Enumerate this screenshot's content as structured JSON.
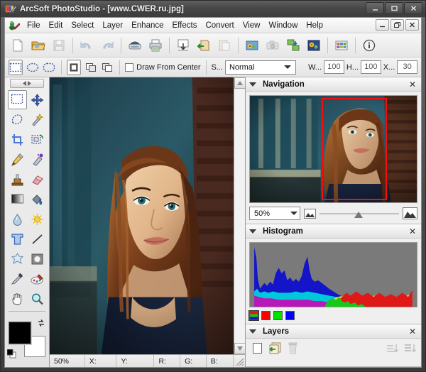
{
  "window": {
    "title": "ArcSoft PhotoStudio - [www.CWER.ru.jpg]",
    "app_icon": "photostudio-icon",
    "controls": {
      "minimize": "_",
      "maximize": "☐",
      "close": "✕"
    }
  },
  "mdi": {
    "icon": "document-icon",
    "controls": {
      "minimize": "_",
      "restore": "❐",
      "close": "✕"
    }
  },
  "menu": {
    "items": [
      {
        "label": "File",
        "name": "menu-file"
      },
      {
        "label": "Edit",
        "name": "menu-edit"
      },
      {
        "label": "Select",
        "name": "menu-select"
      },
      {
        "label": "Layer",
        "name": "menu-layer"
      },
      {
        "label": "Enhance",
        "name": "menu-enhance"
      },
      {
        "label": "Effects",
        "name": "menu-effects"
      },
      {
        "label": "Convert",
        "name": "menu-convert"
      },
      {
        "label": "View",
        "name": "menu-view"
      },
      {
        "label": "Window",
        "name": "menu-window"
      },
      {
        "label": "Help",
        "name": "menu-help"
      }
    ]
  },
  "toolbar": {
    "buttons": [
      {
        "icon": "new-file-icon",
        "name": "new-button"
      },
      {
        "icon": "open-folder-icon",
        "name": "open-button"
      },
      {
        "icon": "save-disk-icon",
        "name": "save-button"
      },
      {
        "icon": "undo-arrow-icon",
        "name": "undo-button"
      },
      {
        "icon": "redo-arrow-icon",
        "name": "redo-button"
      },
      {
        "icon": "scanner-icon",
        "name": "acquire-button"
      },
      {
        "icon": "printer-icon",
        "name": "print-button"
      },
      {
        "icon": "import-icon",
        "name": "import-button"
      },
      {
        "icon": "export-icon",
        "name": "export-button"
      },
      {
        "icon": "paste-icon",
        "name": "paste-button"
      },
      {
        "icon": "album-icon",
        "name": "album-button"
      },
      {
        "icon": "camera-icon",
        "name": "camera-button"
      },
      {
        "icon": "batch-icon",
        "name": "batch-button"
      },
      {
        "icon": "enhance-photo-icon",
        "name": "enhance-button"
      },
      {
        "icon": "contact-sheet-icon",
        "name": "contact-sheet-button"
      },
      {
        "icon": "info-icon",
        "name": "info-button"
      }
    ]
  },
  "options": {
    "shapes": [
      {
        "icon": "rect-marquee-icon",
        "name": "shape-rectangle",
        "selected": true
      },
      {
        "icon": "ellipse-marquee-icon",
        "name": "shape-ellipse",
        "selected": false
      },
      {
        "icon": "rounded-marquee-icon",
        "name": "shape-rounded",
        "selected": false
      }
    ],
    "modes": [
      {
        "icon": "new-selection-icon",
        "name": "mode-new",
        "selected": true
      },
      {
        "icon": "add-selection-icon",
        "name": "mode-add",
        "selected": false
      },
      {
        "icon": "subtract-selection-icon",
        "name": "mode-subtract",
        "selected": false
      }
    ],
    "draw_from_center_label": "Draw From Center",
    "draw_from_center_checked": false,
    "style_label": "S...",
    "style_value": "Normal",
    "width_label": "W...",
    "width_value": "100",
    "height_label": "H...",
    "height_value": "100",
    "x_label": "X...",
    "x_value": "30"
  },
  "toolbox": {
    "handle_icon": "collapse-arrows-icon",
    "tools": [
      {
        "icon": "rectangle-select-icon",
        "name": "tool-rectangle-select",
        "selected": true
      },
      {
        "icon": "move-icon",
        "name": "tool-move",
        "selected": false
      },
      {
        "icon": "lasso-icon",
        "name": "tool-lasso",
        "selected": false
      },
      {
        "icon": "magic-wand-icon",
        "name": "tool-magic-wand",
        "selected": false
      },
      {
        "icon": "crop-icon",
        "name": "tool-crop",
        "selected": false
      },
      {
        "icon": "transform-icon",
        "name": "tool-transform",
        "selected": false
      },
      {
        "icon": "pencil-icon",
        "name": "tool-pencil",
        "selected": false
      },
      {
        "icon": "airbrush-icon",
        "name": "tool-airbrush",
        "selected": false
      },
      {
        "icon": "clone-stamp-icon",
        "name": "tool-clone-stamp",
        "selected": false
      },
      {
        "icon": "eraser-icon",
        "name": "tool-eraser",
        "selected": false
      },
      {
        "icon": "gradient-icon",
        "name": "tool-gradient",
        "selected": false
      },
      {
        "icon": "paint-bucket-icon",
        "name": "tool-paint-bucket",
        "selected": false
      },
      {
        "icon": "blur-drop-icon",
        "name": "tool-blur",
        "selected": false
      },
      {
        "icon": "dodge-sun-icon",
        "name": "tool-dodge",
        "selected": false
      },
      {
        "icon": "text-icon",
        "name": "tool-text",
        "selected": false
      },
      {
        "icon": "line-icon",
        "name": "tool-line",
        "selected": false
      },
      {
        "icon": "shape-star-icon",
        "name": "tool-shape",
        "selected": false
      },
      {
        "icon": "button-shape-icon",
        "name": "tool-button-shape",
        "selected": false
      },
      {
        "icon": "eyedropper-icon",
        "name": "tool-eyedropper",
        "selected": false
      },
      {
        "icon": "palette-icon",
        "name": "tool-palette",
        "selected": false
      },
      {
        "icon": "hand-icon",
        "name": "tool-hand",
        "selected": false
      },
      {
        "icon": "zoom-magnifier-icon",
        "name": "tool-zoom",
        "selected": false
      }
    ],
    "foreground_color": "#000000",
    "background_color": "#ffffff",
    "swap_icon": "swap-colors-icon",
    "default_icon": "default-colors-icon"
  },
  "panels": {
    "navigation": {
      "title": "Navigation",
      "close_glyph": "✕",
      "zoom_value": "50%",
      "small_image_icon": "small-image-icon",
      "large_image_icon": "large-image-icon",
      "view_rect_color": "#f01010"
    },
    "histogram": {
      "title": "Histogram",
      "close_glyph": "✕",
      "channels": [
        {
          "name": "channel-rgb",
          "label": "RGB",
          "color": "#ffffff",
          "selected": true
        },
        {
          "name": "channel-red",
          "label": "Red",
          "color": "#ff0000",
          "selected": false
        },
        {
          "name": "channel-green",
          "label": "Green",
          "color": "#00e000",
          "selected": false
        },
        {
          "name": "channel-blue",
          "label": "Blue",
          "color": "#0000ff",
          "selected": false
        }
      ]
    },
    "layers": {
      "title": "Layers",
      "close_glyph": "✕",
      "buttons": [
        {
          "icon": "new-layer-icon",
          "name": "new-layer-button"
        },
        {
          "icon": "duplicate-layer-icon",
          "name": "duplicate-layer-button"
        },
        {
          "icon": "delete-layer-icon",
          "name": "delete-layer-button"
        },
        {
          "icon": "merge-down-icon",
          "name": "merge-down-button"
        },
        {
          "icon": "merge-all-icon",
          "name": "merge-all-button"
        }
      ]
    }
  },
  "status_bar": {
    "zoom": "50%",
    "x_label": "X:",
    "y_label": "Y:",
    "r_label": "R:",
    "g_label": "G:",
    "b_label": "B:",
    "grip_icon": "resize-grip-icon"
  },
  "scrollbar": {
    "up_arrow": "▲",
    "down_arrow": "▼"
  }
}
